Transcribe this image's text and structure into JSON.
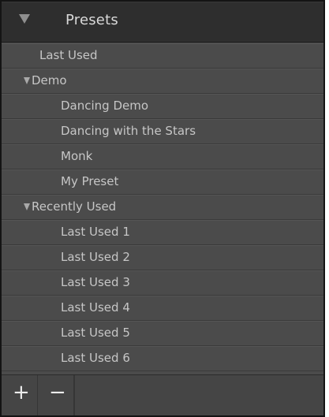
{
  "panel": {
    "title": "Presets",
    "items": [
      {
        "label": "Last Used"
      },
      {
        "label": "Demo",
        "expanded": true
      },
      {
        "label": "Dancing Demo"
      },
      {
        "label": "Dancing with the Stars"
      },
      {
        "label": "Monk"
      },
      {
        "label": "My Preset"
      },
      {
        "label": "Recently Used",
        "expanded": true
      },
      {
        "label": "Last Used 1"
      },
      {
        "label": "Last Used 2"
      },
      {
        "label": "Last Used 3"
      },
      {
        "label": "Last Used 4"
      },
      {
        "label": "Last Used 5"
      },
      {
        "label": "Last Used 6"
      }
    ],
    "footer": {
      "add_symbol": "+",
      "remove_symbol": "−"
    }
  },
  "colors": {
    "header_bg": "#2e2e2e",
    "panel_bg": "#4b4b4b",
    "text": "#c6c6c6"
  }
}
